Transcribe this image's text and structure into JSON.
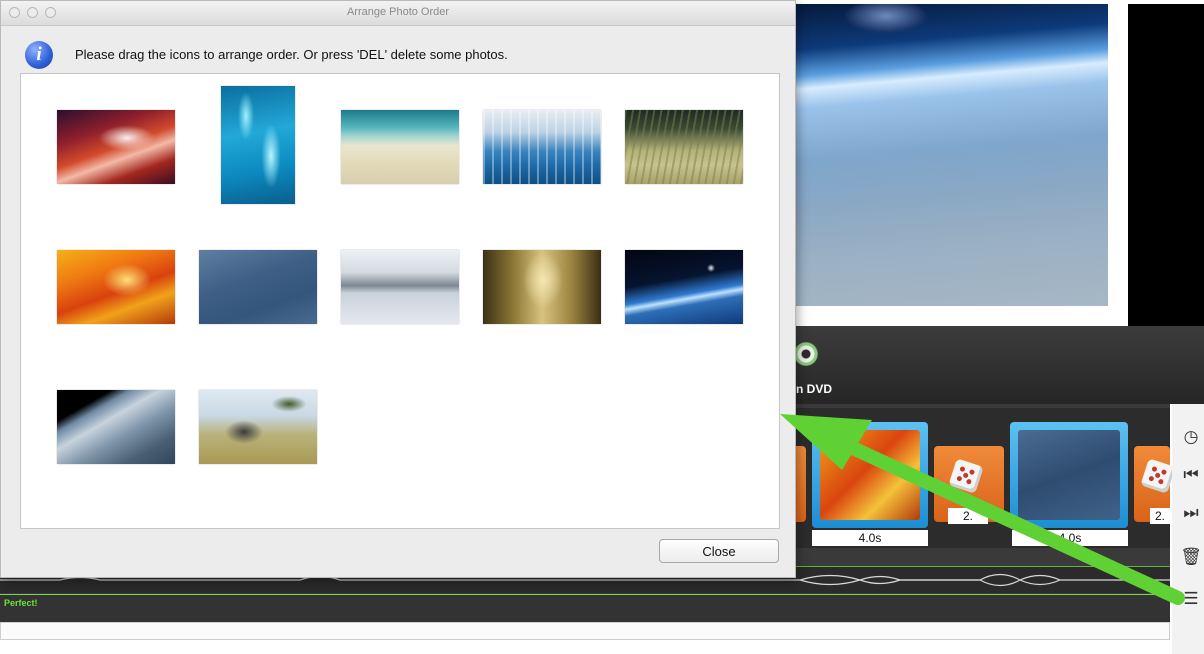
{
  "dialog": {
    "title": "Arrange Photo Order",
    "message": "Please drag the icons to arrange order. Or press 'DEL' delete some photos.",
    "close_label": "Close",
    "info_glyph": "i"
  },
  "photos": [
    {
      "name": "red canyon"
    },
    {
      "name": "blue water"
    },
    {
      "name": "beach shore"
    },
    {
      "name": "blue reeds"
    },
    {
      "name": "grass field"
    },
    {
      "name": "orange abstract"
    },
    {
      "name": "blue texture"
    },
    {
      "name": "misty lake"
    },
    {
      "name": "golden cliffs bird"
    },
    {
      "name": "earth from space"
    },
    {
      "name": "earth horizon"
    },
    {
      "name": "elephant savanna"
    }
  ],
  "background_app": {
    "burn_label": "n DVD",
    "clip_durations": [
      "4.0s",
      "2.",
      "2.",
      "4.0s"
    ],
    "track_label": "Perfect!",
    "tools": [
      "clock-icon",
      "skip-back-icon",
      "skip-forward-icon",
      "trash-icon",
      "list-icon"
    ]
  },
  "colors": {
    "highlight_arrow": "#5fd135",
    "clip_orange": "#e8772a",
    "clip_blue": "#2f9de0"
  }
}
